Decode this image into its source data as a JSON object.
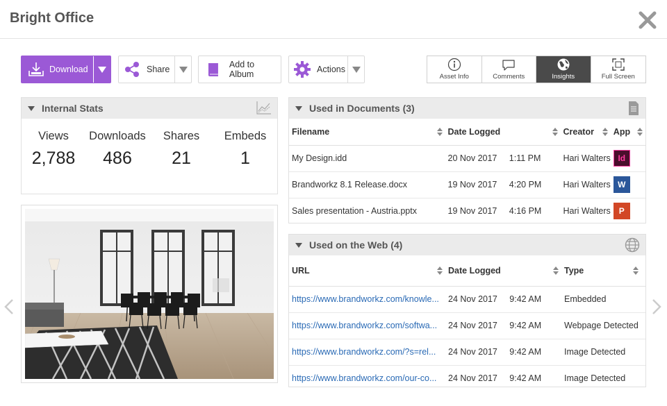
{
  "window": {
    "title": "Bright Office"
  },
  "toolbar": {
    "download_label": "Download",
    "share_label": "Share",
    "album_label": "Add to Album",
    "actions_label": "Actions"
  },
  "view_tabs": [
    {
      "label": "Asset Info",
      "icon": "info-icon"
    },
    {
      "label": "Comments",
      "icon": "comment-icon"
    },
    {
      "label": "Insights",
      "icon": "globe-icon",
      "active": true
    },
    {
      "label": "Full Screen",
      "icon": "fullscreen-icon"
    }
  ],
  "internal_stats": {
    "title": "Internal Stats",
    "stats": [
      {
        "label": "Views",
        "value": "2,788"
      },
      {
        "label": "Downloads",
        "value": "486"
      },
      {
        "label": "Shares",
        "value": "21"
      },
      {
        "label": "Embeds",
        "value": "1"
      }
    ]
  },
  "used_in_documents": {
    "title": "Used in Documents (3)",
    "columns": [
      "Filename",
      "Date Logged",
      "Creator",
      "App"
    ],
    "rows": [
      {
        "filename": "My Design.idd",
        "date": "20 Nov 2017",
        "time": "1:11 PM",
        "creator": "Hari Walters",
        "app": "indesign",
        "app_label": "Id"
      },
      {
        "filename": "Brandworkz 8.1 Release.docx",
        "date": "19 Nov 2017",
        "time": "4:20 PM",
        "creator": "Hari Walters",
        "app": "word",
        "app_label": "W"
      },
      {
        "filename": "Sales presentation - Austria.pptx",
        "date": "19 Nov 2017",
        "time": "4:16 PM",
        "creator": "Hari Walters",
        "app": "powerpoint",
        "app_label": "P"
      }
    ]
  },
  "used_on_web": {
    "title": "Used on the Web (4)",
    "columns": [
      "URL",
      "Date Logged",
      "Type"
    ],
    "rows": [
      {
        "url": "https://www.brandworkz.com/knowle...",
        "date": "24 Nov 2017",
        "time": "9:42 AM",
        "type": "Embedded"
      },
      {
        "url": "https://www.brandworkz.com/softwa...",
        "date": "24 Nov 2017",
        "time": "9:42 AM",
        "type": "Webpage Detected"
      },
      {
        "url": "https://www.brandworkz.com/?s=rel...",
        "date": "24 Nov 2017",
        "time": "9:42 AM",
        "type": "Image Detected"
      },
      {
        "url": "https://www.brandworkz.com/our-co...",
        "date": "24 Nov 2017",
        "time": "9:42 AM",
        "type": "Image Detected"
      }
    ]
  },
  "colors": {
    "accent": "#9b59d6",
    "active_tab": "#4a4a4a",
    "link": "#2a6ab5"
  }
}
